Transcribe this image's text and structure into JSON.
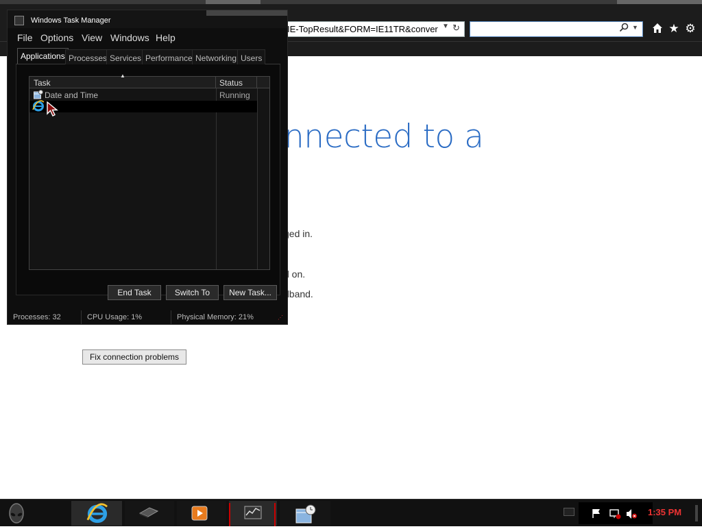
{
  "browser": {
    "address_text": "IE-TopResult&FORM=IE11TR&conver",
    "search_placeholder": "",
    "icons": [
      "home-icon",
      "favorites-star-icon",
      "settings-gear-icon"
    ]
  },
  "page": {
    "heading": "nnected to a",
    "lines": [
      "ged in.",
      "d on.",
      "dband."
    ],
    "fix_button_label": "Fix connection problems"
  },
  "task_manager": {
    "title": "Windows Task Manager",
    "menu": [
      "File",
      "Options",
      "View",
      "Windows",
      "Help"
    ],
    "tabs": [
      "Applications",
      "Processes",
      "Services",
      "Performance",
      "Networking",
      "Users"
    ],
    "active_tab": "Applications",
    "columns": {
      "task": "Task",
      "status": "Status"
    },
    "rows": [
      {
        "name": "Date and Time",
        "status": "Running",
        "icon": "calendar-clock-icon"
      },
      {
        "name": "",
        "status": "",
        "icon": "internet-explorer-icon"
      }
    ],
    "buttons": {
      "end_task": "End Task",
      "switch_to": "Switch To",
      "new_task": "New Task..."
    },
    "status_bar": {
      "processes": "Processes: 32",
      "cpu": "CPU Usage: 1%",
      "memory": "Physical Memory: 21%"
    }
  },
  "taskbar": {
    "pinned": [
      "alienware-start-icon",
      "internet-explorer-icon",
      "network-device-icon",
      "media-player-icon",
      "task-manager-icon",
      "date-time-icon"
    ],
    "clock": "1:35 PM",
    "accent_color": "#cc0000"
  }
}
